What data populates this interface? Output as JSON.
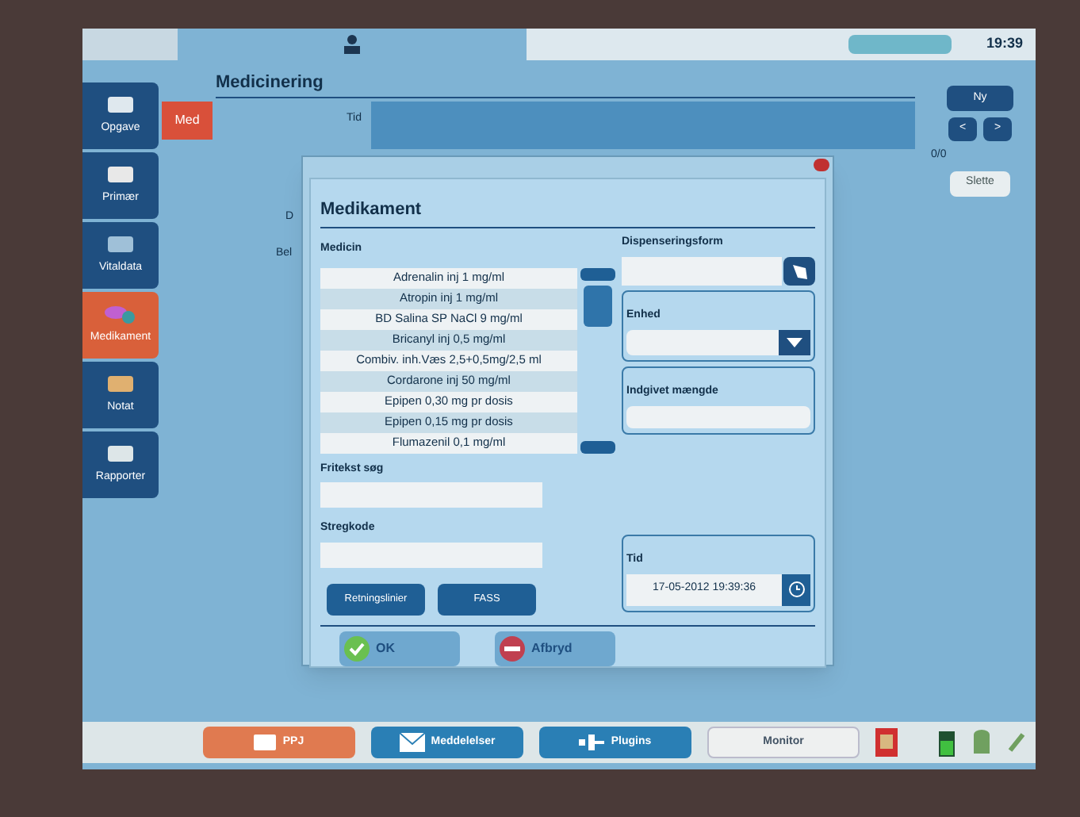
{
  "top_bar": {
    "clock": "19:39"
  },
  "sidebar": {
    "items": [
      {
        "label": "Opgave",
        "selected": false
      },
      {
        "label": "Primær",
        "selected": false
      },
      {
        "label": "Vitaldata",
        "selected": false
      },
      {
        "label": "Medikament",
        "selected": true
      },
      {
        "label": "Notat",
        "selected": false
      },
      {
        "label": "Rapporter",
        "selected": false
      }
    ]
  },
  "tabs": [
    {
      "label": "Med",
      "selected": true
    }
  ],
  "page": {
    "title": "Medicinering",
    "tid_label": "Tid",
    "hidden_labels": [
      "D",
      "Bel"
    ]
  },
  "right_panel": {
    "new_button": "Ny",
    "prev_button": "<",
    "next_button": ">",
    "counter": "0/0",
    "delete_button": "Slette"
  },
  "dialog": {
    "title": "Medikament",
    "medicin_label": "Medicin",
    "medicines": [
      {
        "name": "Adrenalin inj 1 mg/ml",
        "selected": false
      },
      {
        "name": "Atropin inj 1 mg/ml",
        "selected": false
      },
      {
        "name": "BD Salina SP NaCl 9 mg/ml",
        "selected": false
      },
      {
        "name": "Bricanyl inj 0,5 mg/ml",
        "selected": false
      },
      {
        "name": "Combiv. inh.Væs 2,5+0,5mg/2,5 ml",
        "selected": false
      },
      {
        "name": "Cordarone inj 50 mg/ml",
        "selected": false
      },
      {
        "name": "Epipen 0,30 mg pr dosis",
        "selected": false
      },
      {
        "name": "Epipen 0,15 mg pr dosis",
        "selected": false
      },
      {
        "name": "Flumazenil 0,1 mg/ml",
        "selected": false
      }
    ],
    "dispensing_label": "Dispenseringsform",
    "unit_label": "Enhed",
    "amount_label": "Indgivet mængde",
    "freetext_label": "Fritekst søg",
    "barcode_label": "Stregkode",
    "guidelines_button": "Retningslinier",
    "fass_button": "FASS",
    "time_label": "Tid",
    "time_value": "17-05-2012 19:39:36",
    "ok_button": "OK",
    "cancel_button": "Afbryd"
  },
  "taskbar": [
    {
      "label": "PPJ",
      "color": "#e07a50"
    },
    {
      "label": "Meddelelser",
      "color": "#2a7fb5"
    },
    {
      "label": "Plugins",
      "color": "#2a7fb5"
    },
    {
      "label": "Monitor",
      "color": "#eef0f0"
    }
  ]
}
